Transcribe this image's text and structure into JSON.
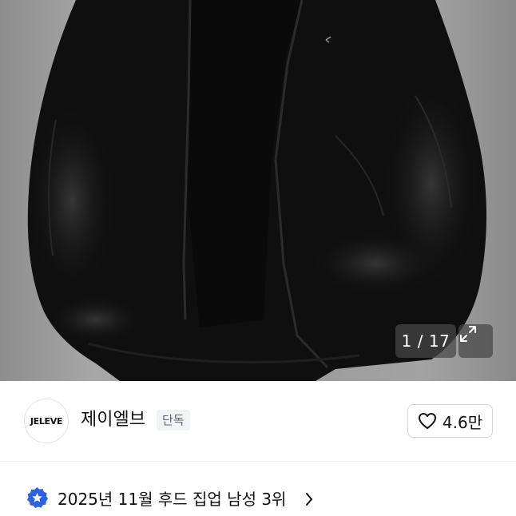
{
  "gallery": {
    "counter": "1 / 17",
    "image_alt": "black velvet hooded zip-up jacket",
    "expand_icon": "expand-icon"
  },
  "brand": {
    "logo_text": "JELEVE",
    "name": "제이엘브",
    "badge": "단독"
  },
  "like": {
    "icon": "heart-icon",
    "count": "4.6만"
  },
  "ranking": {
    "icon": "ranking-badge-icon",
    "text": "2025년 11월 후드 집업 남성 3위",
    "chevron": "chevron-right-icon",
    "accent": "#2d63e2"
  }
}
